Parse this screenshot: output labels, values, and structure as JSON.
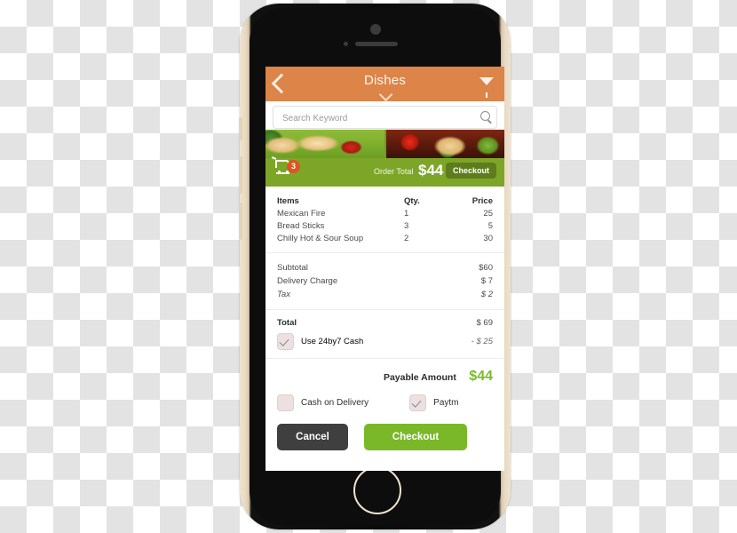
{
  "device": {
    "name": "smartphone-mockup",
    "home_button": "home-button",
    "camera": "camera-icon",
    "earpiece": "earpiece-speaker"
  },
  "topbar": {
    "back_icon": "back-chevron-icon",
    "title": "Dishes",
    "caret_icon": "chevron-down-icon",
    "filter_icon": "filter-funnel-icon",
    "bg_color": "#dd8448"
  },
  "search": {
    "placeholder": "Search Keyword",
    "value": "",
    "icon": "search-icon"
  },
  "banner": {
    "tiles": [
      {
        "name": "food-photo-wraps"
      },
      {
        "name": "food-photo-burger"
      }
    ]
  },
  "order_bar": {
    "cart_icon": "shopping-cart-icon",
    "cart_count": "3",
    "order_total_label": "Order Total",
    "order_total_value": "$44",
    "checkout_label": "Checkout",
    "bg_color": "#7da629",
    "badge_color": "#e0541f"
  },
  "items_table": {
    "headers": {
      "item": "Items",
      "qty": "Qty.",
      "price": "Price"
    },
    "rows": [
      {
        "item": "Mexican Fire",
        "qty": "1",
        "price": "25"
      },
      {
        "item": "Bread Sticks",
        "qty": "3",
        "price": "5"
      },
      {
        "item": "Chilly Hot & Sour Soup",
        "qty": "2",
        "price": "30"
      }
    ]
  },
  "charges": {
    "rows": [
      {
        "label": "Subtotal",
        "amount": "$60"
      },
      {
        "label": "Delivery Charge",
        "amount": "$ 7"
      },
      {
        "label": "Tax",
        "amount": "$ 2"
      }
    ]
  },
  "total": {
    "label": "Total",
    "value": "$ 69",
    "cash_checkbox_checked": true,
    "cash_label": "Use 24by7 Cash",
    "cash_discount": "- $ 25"
  },
  "payable": {
    "label": "Payable Amount",
    "value": "$44",
    "color": "#79bb2a"
  },
  "payment_options": [
    {
      "label": "Cash on Delivery",
      "checked": false
    },
    {
      "label": "Paytm",
      "checked": true
    }
  ],
  "actions": {
    "cancel_label": "Cancel",
    "checkout_label": "Checkout",
    "cancel_color": "#3f3f3f",
    "checkout_color": "#7ab829"
  }
}
